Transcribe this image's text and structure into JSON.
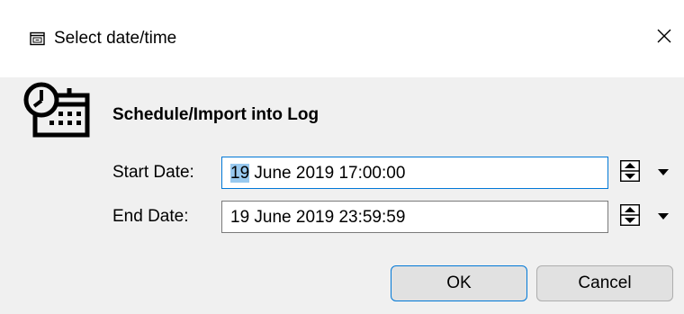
{
  "window": {
    "title": "Select date/time",
    "title_icon": "calendar-window-icon",
    "close_icon": "close-icon"
  },
  "dialog": {
    "icon": "clock-calendar-icon",
    "heading": "Schedule/Import into Log"
  },
  "start_date": {
    "label": "Start Date:",
    "selected_part": "19",
    "rest": " June 2019 17:00:00",
    "focused": true
  },
  "end_date": {
    "label": "End Date:",
    "value": "19 June 2019 23:59:59"
  },
  "buttons": {
    "ok_label": "OK",
    "cancel_label": "Cancel"
  },
  "colors": {
    "focus_border": "#0078d7",
    "selection": "#99c9ef",
    "dialog_bg": "#f0f0f0"
  }
}
